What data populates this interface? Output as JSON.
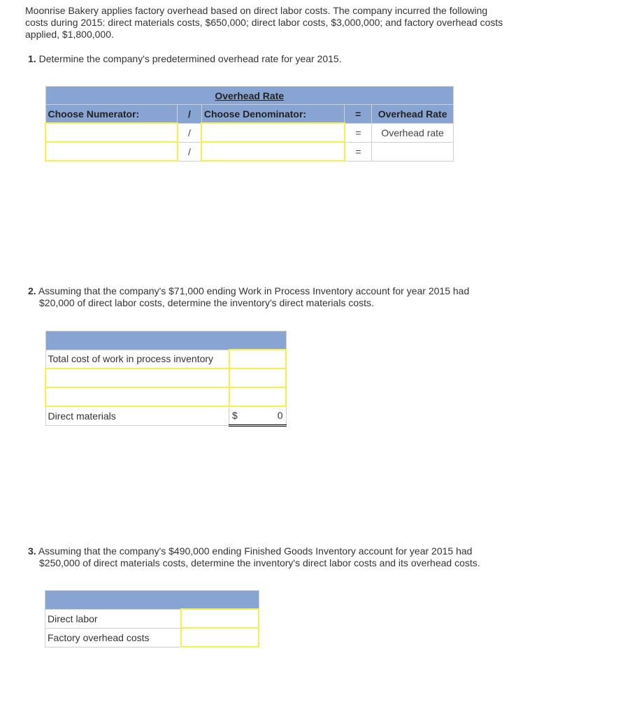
{
  "intro": "Moonrise Bakery applies factory overhead based on direct labor costs. The company incurred the following costs during 2015: direct materials costs, $650,000; direct labor costs, $3,000,000; and factory overhead costs applied, $1,800,000.",
  "q1": {
    "number": "1.",
    "text": "Determine the company's predetermined overhead rate for year 2015.",
    "table": {
      "title": "Overhead Rate",
      "numerator_header": "Choose Numerator:",
      "divide_symbol": "/",
      "denominator_header": "Choose Denominator:",
      "equals_symbol": "=",
      "result_header": "Overhead Rate",
      "rows": [
        {
          "numerator": "",
          "denominator": "",
          "result": "Overhead rate"
        },
        {
          "numerator": "",
          "denominator": "",
          "result": ""
        }
      ]
    }
  },
  "q2": {
    "number": "2.",
    "line1": "Assuming that the company's $71,000 ending Work in Process Inventory account for year 2015 had",
    "line2": "$20,000 of direct labor costs, determine the inventory's direct materials costs.",
    "table": {
      "rows": [
        {
          "label": "Total cost of work in process inventory",
          "value": ""
        },
        {
          "label": "",
          "value": ""
        },
        {
          "label": "",
          "value": ""
        }
      ],
      "total_label": "Direct materials",
      "total_currency": "$",
      "total_value": "0"
    }
  },
  "q3": {
    "number": "3.",
    "line1": "Assuming that the company's $490,000 ending Finished Goods Inventory account for year 2015 had",
    "line2": "$250,000 of direct materials costs, determine the inventory's direct labor costs and its overhead costs.",
    "table": {
      "rows": [
        {
          "label": "Direct labor",
          "value": ""
        },
        {
          "label": "Factory overhead costs",
          "value": ""
        }
      ]
    }
  }
}
